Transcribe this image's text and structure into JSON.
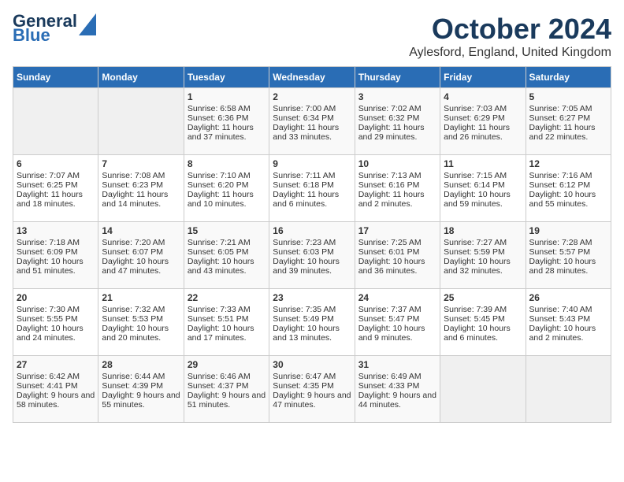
{
  "logo": {
    "line1": "General",
    "line2": "Blue"
  },
  "title": "October 2024",
  "subtitle": "Aylesford, England, United Kingdom",
  "days_of_week": [
    "Sunday",
    "Monday",
    "Tuesday",
    "Wednesday",
    "Thursday",
    "Friday",
    "Saturday"
  ],
  "weeks": [
    [
      {
        "day": "",
        "content": ""
      },
      {
        "day": "",
        "content": ""
      },
      {
        "day": "1",
        "content": "Sunrise: 6:58 AM\nSunset: 6:36 PM\nDaylight: 11 hours and 37 minutes."
      },
      {
        "day": "2",
        "content": "Sunrise: 7:00 AM\nSunset: 6:34 PM\nDaylight: 11 hours and 33 minutes."
      },
      {
        "day": "3",
        "content": "Sunrise: 7:02 AM\nSunset: 6:32 PM\nDaylight: 11 hours and 29 minutes."
      },
      {
        "day": "4",
        "content": "Sunrise: 7:03 AM\nSunset: 6:29 PM\nDaylight: 11 hours and 26 minutes."
      },
      {
        "day": "5",
        "content": "Sunrise: 7:05 AM\nSunset: 6:27 PM\nDaylight: 11 hours and 22 minutes."
      }
    ],
    [
      {
        "day": "6",
        "content": "Sunrise: 7:07 AM\nSunset: 6:25 PM\nDaylight: 11 hours and 18 minutes."
      },
      {
        "day": "7",
        "content": "Sunrise: 7:08 AM\nSunset: 6:23 PM\nDaylight: 11 hours and 14 minutes."
      },
      {
        "day": "8",
        "content": "Sunrise: 7:10 AM\nSunset: 6:20 PM\nDaylight: 11 hours and 10 minutes."
      },
      {
        "day": "9",
        "content": "Sunrise: 7:11 AM\nSunset: 6:18 PM\nDaylight: 11 hours and 6 minutes."
      },
      {
        "day": "10",
        "content": "Sunrise: 7:13 AM\nSunset: 6:16 PM\nDaylight: 11 hours and 2 minutes."
      },
      {
        "day": "11",
        "content": "Sunrise: 7:15 AM\nSunset: 6:14 PM\nDaylight: 10 hours and 59 minutes."
      },
      {
        "day": "12",
        "content": "Sunrise: 7:16 AM\nSunset: 6:12 PM\nDaylight: 10 hours and 55 minutes."
      }
    ],
    [
      {
        "day": "13",
        "content": "Sunrise: 7:18 AM\nSunset: 6:09 PM\nDaylight: 10 hours and 51 minutes."
      },
      {
        "day": "14",
        "content": "Sunrise: 7:20 AM\nSunset: 6:07 PM\nDaylight: 10 hours and 47 minutes."
      },
      {
        "day": "15",
        "content": "Sunrise: 7:21 AM\nSunset: 6:05 PM\nDaylight: 10 hours and 43 minutes."
      },
      {
        "day": "16",
        "content": "Sunrise: 7:23 AM\nSunset: 6:03 PM\nDaylight: 10 hours and 39 minutes."
      },
      {
        "day": "17",
        "content": "Sunrise: 7:25 AM\nSunset: 6:01 PM\nDaylight: 10 hours and 36 minutes."
      },
      {
        "day": "18",
        "content": "Sunrise: 7:27 AM\nSunset: 5:59 PM\nDaylight: 10 hours and 32 minutes."
      },
      {
        "day": "19",
        "content": "Sunrise: 7:28 AM\nSunset: 5:57 PM\nDaylight: 10 hours and 28 minutes."
      }
    ],
    [
      {
        "day": "20",
        "content": "Sunrise: 7:30 AM\nSunset: 5:55 PM\nDaylight: 10 hours and 24 minutes."
      },
      {
        "day": "21",
        "content": "Sunrise: 7:32 AM\nSunset: 5:53 PM\nDaylight: 10 hours and 20 minutes."
      },
      {
        "day": "22",
        "content": "Sunrise: 7:33 AM\nSunset: 5:51 PM\nDaylight: 10 hours and 17 minutes."
      },
      {
        "day": "23",
        "content": "Sunrise: 7:35 AM\nSunset: 5:49 PM\nDaylight: 10 hours and 13 minutes."
      },
      {
        "day": "24",
        "content": "Sunrise: 7:37 AM\nSunset: 5:47 PM\nDaylight: 10 hours and 9 minutes."
      },
      {
        "day": "25",
        "content": "Sunrise: 7:39 AM\nSunset: 5:45 PM\nDaylight: 10 hours and 6 minutes."
      },
      {
        "day": "26",
        "content": "Sunrise: 7:40 AM\nSunset: 5:43 PM\nDaylight: 10 hours and 2 minutes."
      }
    ],
    [
      {
        "day": "27",
        "content": "Sunrise: 6:42 AM\nSunset: 4:41 PM\nDaylight: 9 hours and 58 minutes."
      },
      {
        "day": "28",
        "content": "Sunrise: 6:44 AM\nSunset: 4:39 PM\nDaylight: 9 hours and 55 minutes."
      },
      {
        "day": "29",
        "content": "Sunrise: 6:46 AM\nSunset: 4:37 PM\nDaylight: 9 hours and 51 minutes."
      },
      {
        "day": "30",
        "content": "Sunrise: 6:47 AM\nSunset: 4:35 PM\nDaylight: 9 hours and 47 minutes."
      },
      {
        "day": "31",
        "content": "Sunrise: 6:49 AM\nSunset: 4:33 PM\nDaylight: 9 hours and 44 minutes."
      },
      {
        "day": "",
        "content": ""
      },
      {
        "day": "",
        "content": ""
      }
    ]
  ]
}
